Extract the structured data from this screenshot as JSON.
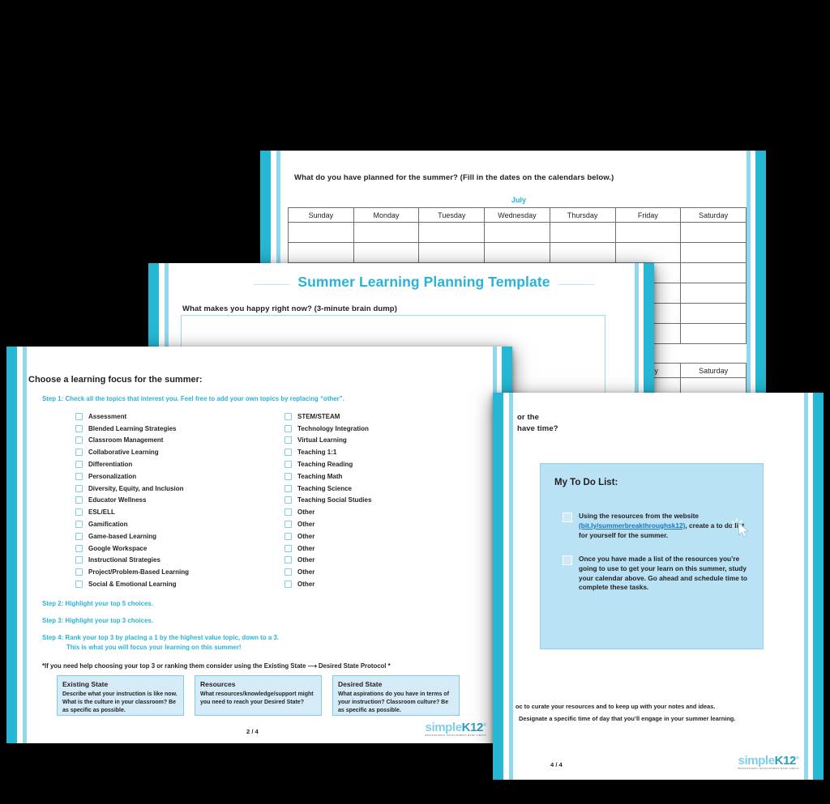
{
  "document": {
    "title": "Summer Learning Planning Template",
    "brand": {
      "logo_light": "simple",
      "logo_bold": "K12",
      "logo_tm": "®",
      "logo_sub": "PROFESSIONAL DEVELOPMENT MADE SIMPLE"
    }
  },
  "page1": {
    "question": "What do you have planned for the summer? (Fill in the dates on the calendars below.)",
    "calendar": {
      "month": "July",
      "days": [
        "Sunday",
        "Monday",
        "Tuesday",
        "Wednesday",
        "Thursday",
        "Friday",
        "Saturday"
      ],
      "blank_rows": 2
    },
    "calendar2_day": "Saturday"
  },
  "page2": {
    "title": "Summer Learning Planning Template",
    "question": "What makes you happy right now? (3-minute brain dump)"
  },
  "page3": {
    "heading": "Choose a learning focus for the summer:",
    "step1": "Step 1: Check all the topics that interest you. Feel free to add your own topics by replacing “other”.",
    "topics_left": [
      "Assessment",
      "Blended Learning Strategies",
      "Classroom Management",
      "Collaborative Learning",
      "Differentiation",
      "Personalization",
      "Diversity, Equity, and Inclusion",
      "Educator Wellness",
      "ESL/ELL",
      "Gamification",
      "Game-based Learning",
      "Google Workspace",
      "Instructional Strategies",
      "Project/Problem-Based Learning",
      "Social & Emotional Learning"
    ],
    "topics_right": [
      "STEM/STEAM",
      "Technology Integration",
      "Virtual Learning",
      "Teaching 1:1",
      "Teaching Reading",
      "Teaching Math",
      "Teaching Science",
      "Teaching Social Studies",
      "Other",
      "Other",
      "Other",
      "Other",
      "Other",
      "Other",
      "Other"
    ],
    "step2": "Step 2: Highlight your top 5 choices.",
    "step3": "Step 3: Highlight your top 3 choices.",
    "step4": "Step 4: Rank your top 3 by placing a 1 by the highest value topic, down to a 3.",
    "step4b": "This is what you will focus your learning on this summer!",
    "note": "*If you need help choosing your top 3 or ranking them consider using the Existing State ⟶ Desired State Protocol *",
    "protocol_boxes": [
      {
        "title": "Existing State",
        "body": "Describe what your instruction is like now. What is the culture in your classroom? Be as specific as possible."
      },
      {
        "title": "Resources",
        "body": "What resources/knowledge/support might you need to reach your Desired State?"
      },
      {
        "title": "Desired State",
        "body": "What aspirations do you have in terms of your instruction? Classroom culture? Be as specific as possible."
      }
    ],
    "page_number": "2 / 4"
  },
  "page4": {
    "top_text_line1": "or the",
    "top_text_line2": "have time?",
    "todo_title": "My To Do List:",
    "todo_items": [
      {
        "pre": "Using the resources from the website ",
        "link": "(bit.ly/summerbreakthroughsk12)",
        "post": ", create a to do list for yourself for the summer."
      },
      {
        "pre": "Once you have made a list of the resources you’re going to use to get your learn on this summer, study your calendar above. Go ahead and schedule time to complete these tasks.",
        "link": "",
        "post": ""
      }
    ],
    "bottom_line1": "oc to curate your resources and to keep up with your notes and ideas.",
    "bottom_line2": "Designate a specific time of day that you’ll engage in your summer learning.",
    "page_number": "4 / 4"
  },
  "colors": {
    "accent_teal": "#25b7d3",
    "accent_light": "#8fd8ee",
    "heading_blue": "#29b3d6",
    "todo_bg": "#b9e2f4",
    "protocol_bg": "#d5ecf8",
    "link": "#1b75bb"
  }
}
